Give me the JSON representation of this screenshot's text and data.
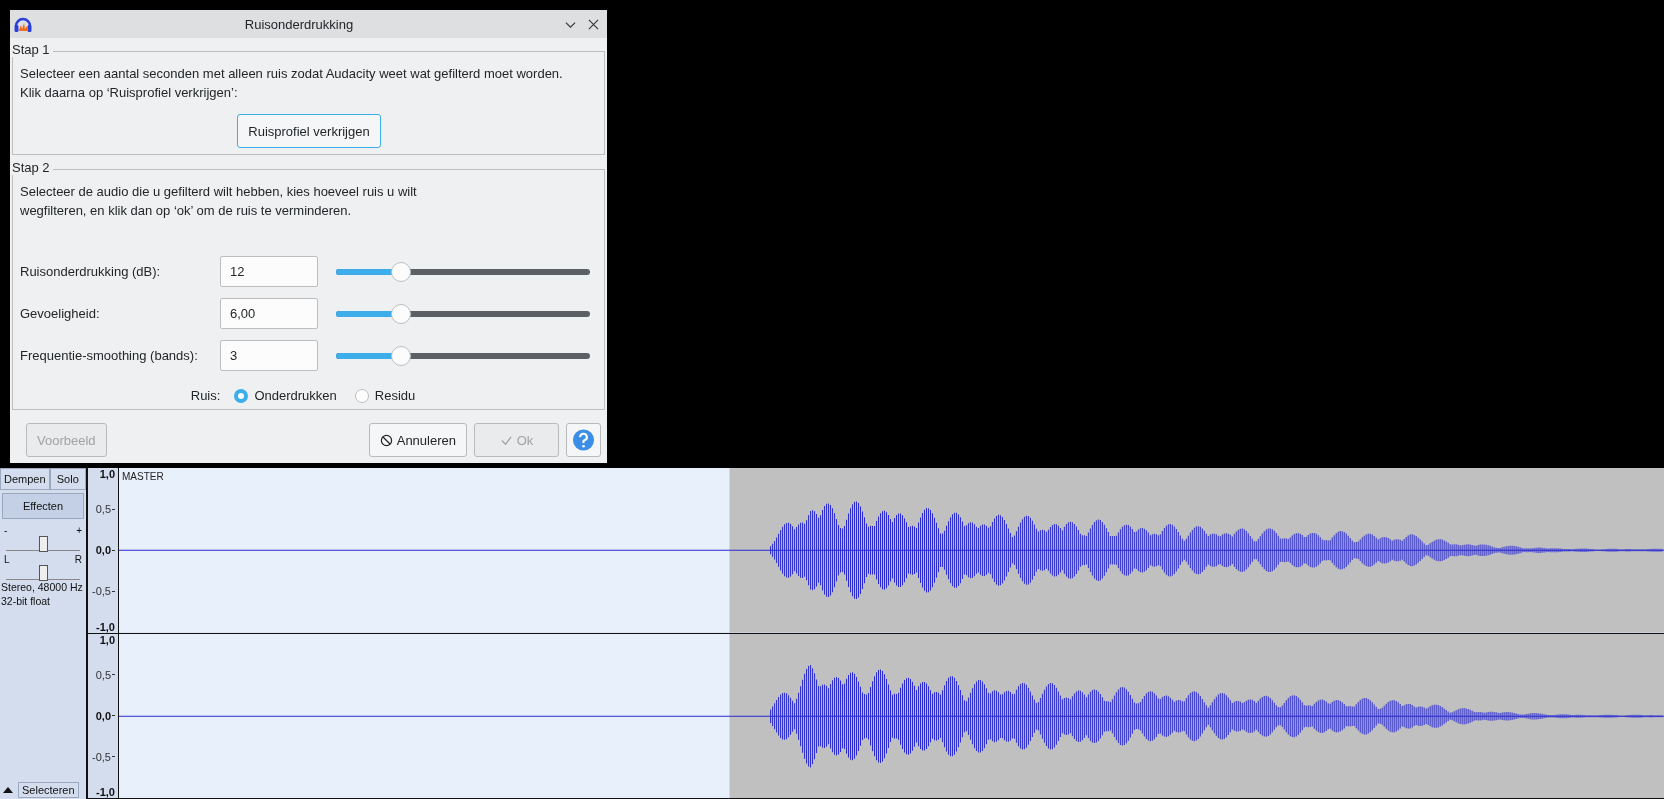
{
  "window": {
    "title": "Ruisonderdrukking"
  },
  "steps": [
    {
      "legend": "Stap 1",
      "lines": [
        "Selecteer een aantal seconden met alleen ruis zodat Audacity weet wat gefilterd moet worden.",
        "Klik daarna op ‘Ruisprofiel verkrijgen’:"
      ],
      "button": "Ruisprofiel verkrijgen"
    },
    {
      "legend": "Stap 2",
      "lines": [
        "Selecteer de audio die u gefilterd wilt hebben, kies hoeveel ruis u wilt",
        "wegfilteren, en klik dan op ‘ok’ om de ruis te verminderen."
      ]
    }
  ],
  "parameters": [
    {
      "label": "Ruisonderdrukking (dB):",
      "value": "12",
      "level": 0.25
    },
    {
      "label": "Gevoeligheid:",
      "value": "6,00",
      "level": 0.25
    },
    {
      "label": "Frequentie-smoothing (bands):",
      "value": "3",
      "level": 0.25
    }
  ],
  "noise": {
    "label": "Ruis:",
    "options": [
      {
        "label": "Onderdrukken",
        "selected": true
      },
      {
        "label": "Residu",
        "selected": false
      }
    ]
  },
  "buttons": [
    {
      "kind": "preview",
      "label": "Voorbeeld",
      "disabled": true
    },
    {
      "kind": "cancel",
      "label": "Annuleren",
      "disabled": false
    },
    {
      "kind": "ok",
      "label": "Ok",
      "disabled": true
    },
    {
      "kind": "help",
      "disabled": false
    }
  ],
  "track": {
    "name": "MASTER",
    "gain": {
      "level": 0.5
    },
    "pan": {
      "level": 0.5
    },
    "mute": "Dempen",
    "solo": "Solo",
    "effects": "Effecten",
    "gain_minus": "-",
    "gain_plus": "+",
    "pan_left": "L",
    "pan_right": "R",
    "info": [
      "Stereo, 48000 Hz",
      "32-bit float"
    ],
    "select": "Selecteren",
    "channels": [
      {
        "ticks": [
          "1,0",
          "0,5",
          "0,0",
          "-0,5",
          "-1,0"
        ]
      },
      {
        "ticks": [
          "1,0",
          "0,5",
          "0,0",
          "-0,5",
          "-1,0"
        ]
      }
    ]
  }
}
